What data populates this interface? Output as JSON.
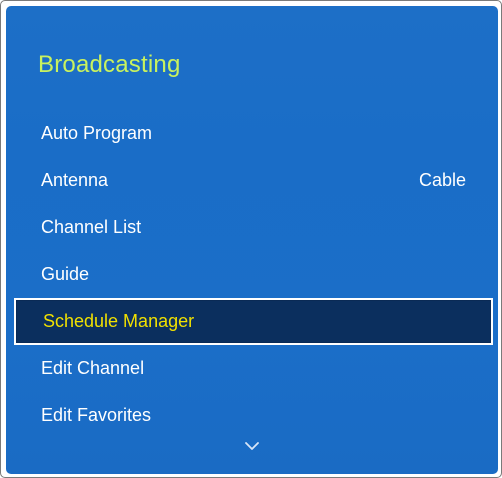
{
  "panel": {
    "title": "Broadcasting"
  },
  "menu": {
    "items": [
      {
        "label": "Auto Program",
        "value": ""
      },
      {
        "label": "Antenna",
        "value": "Cable"
      },
      {
        "label": "Channel List",
        "value": ""
      },
      {
        "label": "Guide",
        "value": ""
      },
      {
        "label": "Schedule Manager",
        "value": "",
        "selected": true
      },
      {
        "label": "Edit Channel",
        "value": ""
      },
      {
        "label": "Edit Favorites",
        "value": ""
      }
    ],
    "more_icon": "chevron-down-icon"
  },
  "colors": {
    "panel_bg": "#1b6ec8",
    "title": "#c9f25e",
    "selected_bg": "#0b2f5e",
    "selected_text": "#f0e000",
    "item_text": "#ffffff"
  }
}
